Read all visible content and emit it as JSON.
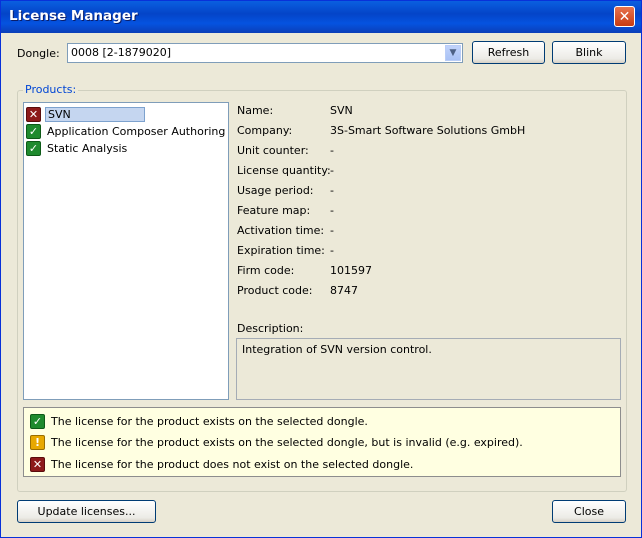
{
  "window": {
    "title": "License Manager",
    "close_symbol": "✕"
  },
  "dongle": {
    "label": "Dongle:",
    "selected": "0008 [2-1879020]",
    "refresh_label": "Refresh",
    "blink_label": "Blink"
  },
  "products": {
    "group_label": "Products:",
    "items": [
      {
        "label": "SVN",
        "status": "missing",
        "icon": "red-x-icon"
      },
      {
        "label": "Application Composer Authoring",
        "status": "ok",
        "icon": "green-check-icon"
      },
      {
        "label": "Static Analysis",
        "status": "ok",
        "icon": "green-check-icon"
      }
    ]
  },
  "details": {
    "name_label": "Name:",
    "name_value": "SVN",
    "company_label": "Company:",
    "company_value": "3S-Smart Software Solutions GmbH",
    "unit_counter_label": "Unit counter:",
    "unit_counter_value": "-",
    "license_quantity_label": "License quantity:",
    "license_quantity_value": "-",
    "usage_period_label": "Usage period:",
    "usage_period_value": "-",
    "feature_map_label": "Feature map:",
    "feature_map_value": "-",
    "activation_time_label": "Activation time:",
    "activation_time_value": "-",
    "expiration_time_label": "Expiration time:",
    "expiration_time_value": "-",
    "firm_code_label": "Firm code:",
    "firm_code_value": "101597",
    "product_code_label": "Product code:",
    "product_code_value": "8747",
    "description_label": "Description:",
    "description_value": "Integration of SVN version control."
  },
  "legend": {
    "ok": "The license for the product exists on the selected dongle.",
    "invalid": "The license for the product exists on the selected dongle, but is invalid (e.g. expired).",
    "missing": "The license for the product does not exist on the selected dongle."
  },
  "footer": {
    "update_label": "Update licenses...",
    "close_label": "Close"
  },
  "colors": {
    "ok": "#1f8a2e",
    "invalid": "#e8a800",
    "missing": "#8d1a1a",
    "titlebar": "#0553e0"
  }
}
